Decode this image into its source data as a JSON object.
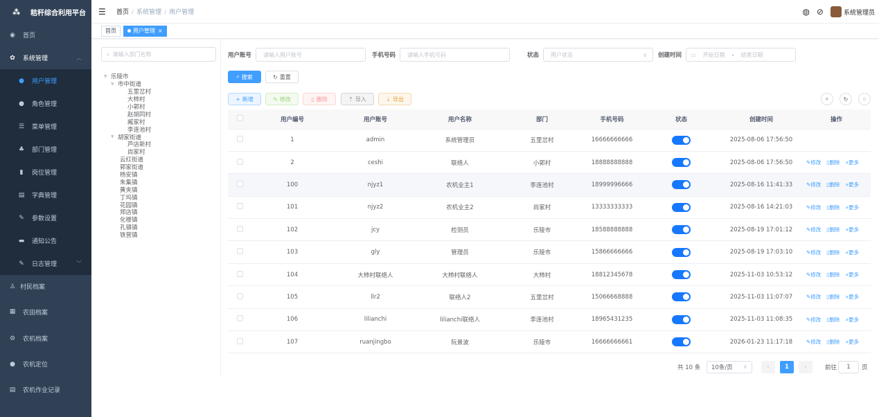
{
  "app": {
    "title": "秸秆综合利用平台"
  },
  "sidebar": {
    "items": [
      {
        "label": "首页",
        "icon": "dashboard-icon"
      },
      {
        "label": "系统管理",
        "icon": "gear-icon"
      },
      {
        "label": "用户管理",
        "icon": "user-icon"
      },
      {
        "label": "角色管理",
        "icon": "peoples-icon"
      },
      {
        "label": "菜单管理",
        "icon": "tree-table-icon"
      },
      {
        "label": "部门管理",
        "icon": "tree-icon"
      },
      {
        "label": "岗位管理",
        "icon": "post-icon"
      },
      {
        "label": "字典管理",
        "icon": "dict-icon"
      },
      {
        "label": "参数设置",
        "icon": "edit-icon"
      },
      {
        "label": "通知公告",
        "icon": "message-icon"
      },
      {
        "label": "日志管理",
        "icon": "log-icon"
      },
      {
        "label": "村民档案",
        "icon": "villager-icon"
      },
      {
        "label": "农田档案",
        "icon": "field-icon"
      },
      {
        "label": "农机档案",
        "icon": "machine-icon"
      },
      {
        "label": "农机定位",
        "icon": "location-icon"
      },
      {
        "label": "农机作业记录",
        "icon": "record-icon"
      }
    ]
  },
  "navbar": {
    "breadcrumb": [
      "首页",
      "系统管理",
      "用户管理"
    ],
    "username": "系统管理员"
  },
  "tags": {
    "home": "首页",
    "active": "用户管理",
    "close": "×"
  },
  "tree": {
    "placeholder": "请输入部门名称",
    "nodes": [
      "乐陵市",
      "市中街道",
      "五里岔村",
      "大柿村",
      "小郭村",
      "赵胡同村",
      "臧家村",
      "李连池村",
      "胡家街道",
      "芦店新村",
      "尚家村",
      "云红街道",
      "郭家街道",
      "杨安镇",
      "朱集镇",
      "黄夹镇",
      "丁坞镇",
      "花园镇",
      "郑店镇",
      "化楼镇",
      "孔镇镇",
      "铁营镇"
    ]
  },
  "search": {
    "account_label": "用户账号",
    "account_placeholder": "请输入用户账号",
    "phone_label": "手机号码",
    "phone_placeholder": "请输入手机号码",
    "status_label": "状态",
    "status_placeholder": "用户状态",
    "time_label": "创建时间",
    "start_placeholder": "开始日期",
    "range_sep": "-",
    "end_placeholder": "结束日期",
    "search_btn": "搜索",
    "reset_btn": "重置"
  },
  "toolbar": {
    "add": "新增",
    "edit": "修改",
    "delete": "删除",
    "import": "导入",
    "export": "导出"
  },
  "table": {
    "columns": [
      "用户编号",
      "用户账号",
      "用户名称",
      "部门",
      "手机号码",
      "状态",
      "创建时间",
      "操作"
    ],
    "ops": {
      "edit": "修改",
      "delete": "删除",
      "more": "更多"
    },
    "rows": [
      {
        "id": "1",
        "account": "admin",
        "name": "系统管理员",
        "dept": "五里岔村",
        "phone": "16666666666",
        "status": true,
        "created": "2025-08-06 17:56:50",
        "ops": false
      },
      {
        "id": "2",
        "account": "ceshi",
        "name": "联络人",
        "dept": "小郭村",
        "phone": "18888888888",
        "status": true,
        "created": "2025-08-06 17:56:50",
        "ops": true
      },
      {
        "id": "100",
        "account": "njyz1",
        "name": "农机业主1",
        "dept": "李连池村",
        "phone": "18999996666",
        "status": true,
        "created": "2025-08-16 11:41:33",
        "ops": true
      },
      {
        "id": "101",
        "account": "njyz2",
        "name": "农机业主2",
        "dept": "尚家村",
        "phone": "13333333333",
        "status": true,
        "created": "2025-08-16 14:21:03",
        "ops": true
      },
      {
        "id": "102",
        "account": "jcy",
        "name": "检测员",
        "dept": "乐陵市",
        "phone": "18588888888",
        "status": true,
        "created": "2025-08-19 17:01:12",
        "ops": true
      },
      {
        "id": "103",
        "account": "gly",
        "name": "管理员",
        "dept": "乐陵市",
        "phone": "15866666666",
        "status": true,
        "created": "2025-08-19 17:03:10",
        "ops": true
      },
      {
        "id": "104",
        "account": "大柿村联络人",
        "name": "大柿村联络人",
        "dept": "大柿村",
        "phone": "18812345678",
        "status": true,
        "created": "2025-11-03 10:53:12",
        "ops": true
      },
      {
        "id": "105",
        "account": "llr2",
        "name": "联络人2",
        "dept": "五里岔村",
        "phone": "15066668888",
        "status": true,
        "created": "2025-11-03 11:07:07",
        "ops": true
      },
      {
        "id": "106",
        "account": "lilianchi",
        "name": "lilianchi联络人",
        "dept": "李连池村",
        "phone": "18965431235",
        "status": true,
        "created": "2025-11-03 11:08:35",
        "ops": true
      },
      {
        "id": "107",
        "account": "ruanjingbo",
        "name": "阮景波",
        "dept": "乐陵市",
        "phone": "16666666661",
        "status": true,
        "created": "2026-01-23 11:17:18",
        "ops": true
      }
    ]
  },
  "pagination": {
    "total": "共 10 条",
    "page_size": "10条/页",
    "current": "1",
    "goto": "前往",
    "goto_value": "1",
    "page_unit": "页"
  },
  "colors": {
    "sidebar_bg": "#304156",
    "accent": "#409eff",
    "switch": "#1677ff"
  }
}
